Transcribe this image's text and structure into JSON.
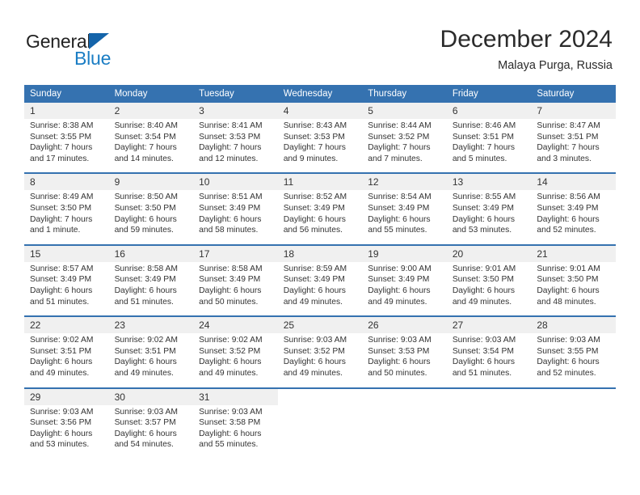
{
  "brand": {
    "name_part1": "General",
    "name_part2": "Blue",
    "triangle_icon": "triangle-icon",
    "color_dark": "#222222",
    "color_blue": "#1a7dc4"
  },
  "header": {
    "title": "December 2024",
    "subtitle": "Malaya Purga, Russia"
  },
  "calendar": {
    "header_bg": "#3572b0",
    "daynum_bg": "#f0f0f0",
    "weekday_headers": [
      "Sunday",
      "Monday",
      "Tuesday",
      "Wednesday",
      "Thursday",
      "Friday",
      "Saturday"
    ],
    "weeks": [
      [
        {
          "day": "1",
          "sunrise": "Sunrise: 8:38 AM",
          "sunset": "Sunset: 3:55 PM",
          "daylight1": "Daylight: 7 hours",
          "daylight2": "and 17 minutes."
        },
        {
          "day": "2",
          "sunrise": "Sunrise: 8:40 AM",
          "sunset": "Sunset: 3:54 PM",
          "daylight1": "Daylight: 7 hours",
          "daylight2": "and 14 minutes."
        },
        {
          "day": "3",
          "sunrise": "Sunrise: 8:41 AM",
          "sunset": "Sunset: 3:53 PM",
          "daylight1": "Daylight: 7 hours",
          "daylight2": "and 12 minutes."
        },
        {
          "day": "4",
          "sunrise": "Sunrise: 8:43 AM",
          "sunset": "Sunset: 3:53 PM",
          "daylight1": "Daylight: 7 hours",
          "daylight2": "and 9 minutes."
        },
        {
          "day": "5",
          "sunrise": "Sunrise: 8:44 AM",
          "sunset": "Sunset: 3:52 PM",
          "daylight1": "Daylight: 7 hours",
          "daylight2": "and 7 minutes."
        },
        {
          "day": "6",
          "sunrise": "Sunrise: 8:46 AM",
          "sunset": "Sunset: 3:51 PM",
          "daylight1": "Daylight: 7 hours",
          "daylight2": "and 5 minutes."
        },
        {
          "day": "7",
          "sunrise": "Sunrise: 8:47 AM",
          "sunset": "Sunset: 3:51 PM",
          "daylight1": "Daylight: 7 hours",
          "daylight2": "and 3 minutes."
        }
      ],
      [
        {
          "day": "8",
          "sunrise": "Sunrise: 8:49 AM",
          "sunset": "Sunset: 3:50 PM",
          "daylight1": "Daylight: 7 hours",
          "daylight2": "and 1 minute."
        },
        {
          "day": "9",
          "sunrise": "Sunrise: 8:50 AM",
          "sunset": "Sunset: 3:50 PM",
          "daylight1": "Daylight: 6 hours",
          "daylight2": "and 59 minutes."
        },
        {
          "day": "10",
          "sunrise": "Sunrise: 8:51 AM",
          "sunset": "Sunset: 3:49 PM",
          "daylight1": "Daylight: 6 hours",
          "daylight2": "and 58 minutes."
        },
        {
          "day": "11",
          "sunrise": "Sunrise: 8:52 AM",
          "sunset": "Sunset: 3:49 PM",
          "daylight1": "Daylight: 6 hours",
          "daylight2": "and 56 minutes."
        },
        {
          "day": "12",
          "sunrise": "Sunrise: 8:54 AM",
          "sunset": "Sunset: 3:49 PM",
          "daylight1": "Daylight: 6 hours",
          "daylight2": "and 55 minutes."
        },
        {
          "day": "13",
          "sunrise": "Sunrise: 8:55 AM",
          "sunset": "Sunset: 3:49 PM",
          "daylight1": "Daylight: 6 hours",
          "daylight2": "and 53 minutes."
        },
        {
          "day": "14",
          "sunrise": "Sunrise: 8:56 AM",
          "sunset": "Sunset: 3:49 PM",
          "daylight1": "Daylight: 6 hours",
          "daylight2": "and 52 minutes."
        }
      ],
      [
        {
          "day": "15",
          "sunrise": "Sunrise: 8:57 AM",
          "sunset": "Sunset: 3:49 PM",
          "daylight1": "Daylight: 6 hours",
          "daylight2": "and 51 minutes."
        },
        {
          "day": "16",
          "sunrise": "Sunrise: 8:58 AM",
          "sunset": "Sunset: 3:49 PM",
          "daylight1": "Daylight: 6 hours",
          "daylight2": "and 51 minutes."
        },
        {
          "day": "17",
          "sunrise": "Sunrise: 8:58 AM",
          "sunset": "Sunset: 3:49 PM",
          "daylight1": "Daylight: 6 hours",
          "daylight2": "and 50 minutes."
        },
        {
          "day": "18",
          "sunrise": "Sunrise: 8:59 AM",
          "sunset": "Sunset: 3:49 PM",
          "daylight1": "Daylight: 6 hours",
          "daylight2": "and 49 minutes."
        },
        {
          "day": "19",
          "sunrise": "Sunrise: 9:00 AM",
          "sunset": "Sunset: 3:49 PM",
          "daylight1": "Daylight: 6 hours",
          "daylight2": "and 49 minutes."
        },
        {
          "day": "20",
          "sunrise": "Sunrise: 9:01 AM",
          "sunset": "Sunset: 3:50 PM",
          "daylight1": "Daylight: 6 hours",
          "daylight2": "and 49 minutes."
        },
        {
          "day": "21",
          "sunrise": "Sunrise: 9:01 AM",
          "sunset": "Sunset: 3:50 PM",
          "daylight1": "Daylight: 6 hours",
          "daylight2": "and 48 minutes."
        }
      ],
      [
        {
          "day": "22",
          "sunrise": "Sunrise: 9:02 AM",
          "sunset": "Sunset: 3:51 PM",
          "daylight1": "Daylight: 6 hours",
          "daylight2": "and 49 minutes."
        },
        {
          "day": "23",
          "sunrise": "Sunrise: 9:02 AM",
          "sunset": "Sunset: 3:51 PM",
          "daylight1": "Daylight: 6 hours",
          "daylight2": "and 49 minutes."
        },
        {
          "day": "24",
          "sunrise": "Sunrise: 9:02 AM",
          "sunset": "Sunset: 3:52 PM",
          "daylight1": "Daylight: 6 hours",
          "daylight2": "and 49 minutes."
        },
        {
          "day": "25",
          "sunrise": "Sunrise: 9:03 AM",
          "sunset": "Sunset: 3:52 PM",
          "daylight1": "Daylight: 6 hours",
          "daylight2": "and 49 minutes."
        },
        {
          "day": "26",
          "sunrise": "Sunrise: 9:03 AM",
          "sunset": "Sunset: 3:53 PM",
          "daylight1": "Daylight: 6 hours",
          "daylight2": "and 50 minutes."
        },
        {
          "day": "27",
          "sunrise": "Sunrise: 9:03 AM",
          "sunset": "Sunset: 3:54 PM",
          "daylight1": "Daylight: 6 hours",
          "daylight2": "and 51 minutes."
        },
        {
          "day": "28",
          "sunrise": "Sunrise: 9:03 AM",
          "sunset": "Sunset: 3:55 PM",
          "daylight1": "Daylight: 6 hours",
          "daylight2": "and 52 minutes."
        }
      ],
      [
        {
          "day": "29",
          "sunrise": "Sunrise: 9:03 AM",
          "sunset": "Sunset: 3:56 PM",
          "daylight1": "Daylight: 6 hours",
          "daylight2": "and 53 minutes."
        },
        {
          "day": "30",
          "sunrise": "Sunrise: 9:03 AM",
          "sunset": "Sunset: 3:57 PM",
          "daylight1": "Daylight: 6 hours",
          "daylight2": "and 54 minutes."
        },
        {
          "day": "31",
          "sunrise": "Sunrise: 9:03 AM",
          "sunset": "Sunset: 3:58 PM",
          "daylight1": "Daylight: 6 hours",
          "daylight2": "and 55 minutes."
        },
        {
          "day": "",
          "sunrise": "",
          "sunset": "",
          "daylight1": "",
          "daylight2": ""
        },
        {
          "day": "",
          "sunrise": "",
          "sunset": "",
          "daylight1": "",
          "daylight2": ""
        },
        {
          "day": "",
          "sunrise": "",
          "sunset": "",
          "daylight1": "",
          "daylight2": ""
        },
        {
          "day": "",
          "sunrise": "",
          "sunset": "",
          "daylight1": "",
          "daylight2": ""
        }
      ]
    ]
  }
}
